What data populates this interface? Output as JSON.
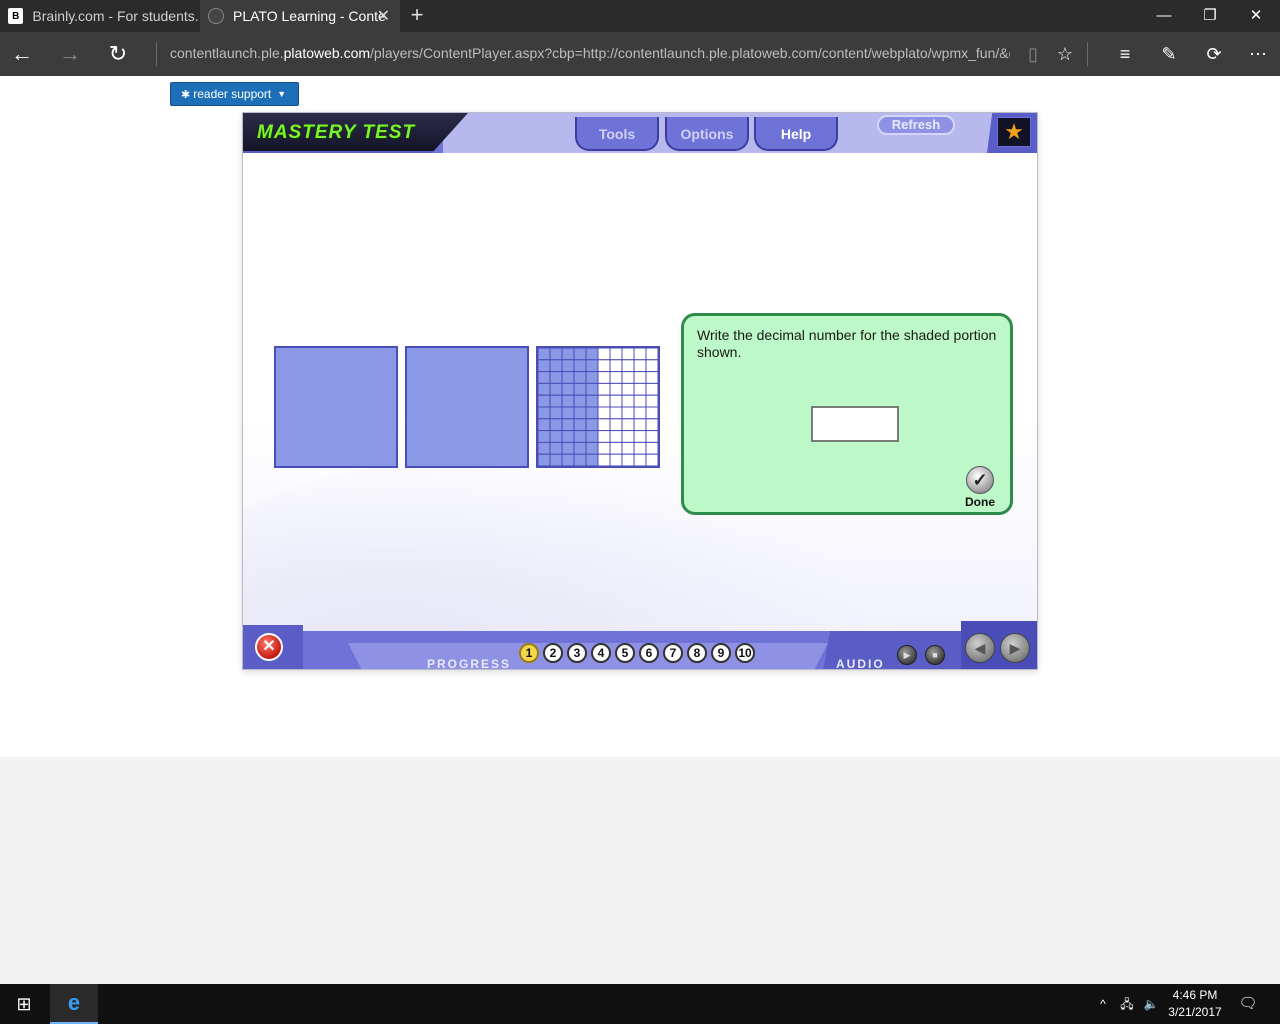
{
  "browser": {
    "tabs": [
      {
        "title": "Brainly.com - For students. I",
        "active": false
      },
      {
        "title": "PLATO Learning - Conte",
        "active": true
      }
    ],
    "url_prefix": "contentlaunch.ple.",
    "url_domain": "platoweb.com",
    "url_rest": "/players/ContentPlayer.aspx?cbp=http://contentlaunch.ple.platoweb.com/content/webplato/wpmx_fun/&cwltype"
  },
  "page": {
    "reader_support_label": "reader support"
  },
  "player": {
    "title": "MASTERY TEST",
    "tabs": {
      "tools": "Tools",
      "options": "Options",
      "help": "Help"
    },
    "refresh_label": "Refresh",
    "question": "Write the decimal number for the shaded portion shown.",
    "answer_value": "",
    "done_label": "Done",
    "progress_label": "PROGRESS",
    "progress_items": [
      "1",
      "2",
      "3",
      "4",
      "5",
      "6",
      "7",
      "8",
      "9",
      "10"
    ],
    "current_question": 1,
    "audio_label": "AUDIO"
  },
  "models": {
    "full_squares": 2,
    "partial_grid": {
      "rows": 10,
      "cols": 10,
      "shaded_columns": 5
    },
    "shade_color": "#8b98e6",
    "border_color": "#4a4db8"
  },
  "taskbar": {
    "time": "4:46 PM",
    "date": "3/21/2017"
  }
}
